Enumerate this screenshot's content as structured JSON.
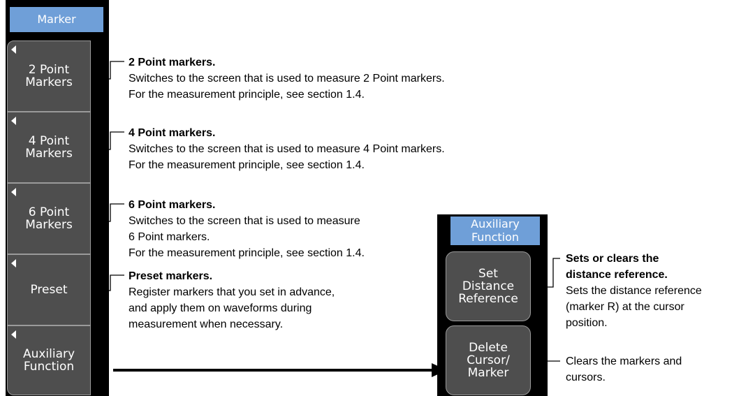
{
  "left_menu": {
    "header": "Marker",
    "keys": [
      {
        "label": "2 Point\nMarkers"
      },
      {
        "label": "4 Point\nMarkers"
      },
      {
        "label": "6 Point\nMarkers"
      },
      {
        "label": "Preset"
      },
      {
        "label": "Auxiliary\nFunction"
      }
    ]
  },
  "descriptions": [
    {
      "title": "2 Point markers.",
      "body": "Switches to the screen that is used to measure 2 Point markers.\nFor the measurement principle, see section 1.4."
    },
    {
      "title": "4 Point markers.",
      "body": "Switches to the screen that is used to measure 4 Point markers.\nFor the measurement principle, see section 1.4."
    },
    {
      "title": "6 Point markers.",
      "body": "Switches to the screen that is used to measure\n6 Point markers.\nFor the measurement principle, see section 1.4."
    },
    {
      "title": "Preset markers.",
      "body": "Register markers that you set in advance,\nand apply them on waveforms during\nmeasurement when necessary."
    }
  ],
  "right_menu": {
    "header": "Auxiliary\nFunction",
    "keys": [
      {
        "label": "Set\nDistance\nReference"
      },
      {
        "label": "Delete\nCursor/\nMarker"
      }
    ]
  },
  "right_descriptions": [
    {
      "title": "Sets or clears the\ndistance reference.",
      "body": "Sets the distance reference\n(marker R) at the cursor\nposition."
    },
    {
      "title": "",
      "body": "Clears the markers and\ncursors."
    }
  ]
}
